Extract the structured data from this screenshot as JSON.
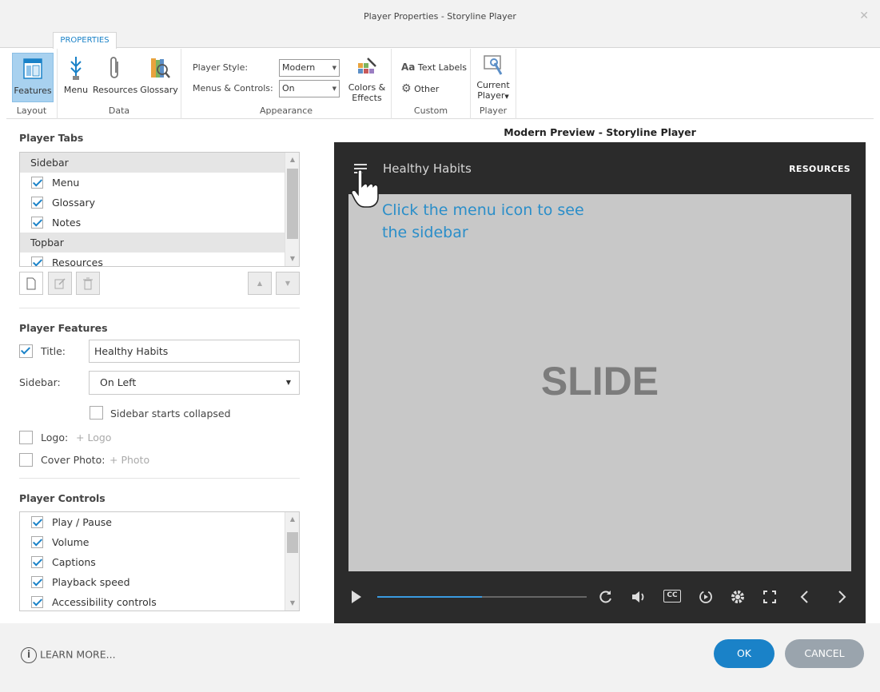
{
  "window": {
    "title": "Player Properties - Storyline Player"
  },
  "ribbon": {
    "tab": "PROPERTIES",
    "groups": {
      "layout": {
        "label": "Layout",
        "features": "Features"
      },
      "data": {
        "label": "Data",
        "menu": "Menu",
        "resources": "Resources",
        "glossary": "Glossary"
      },
      "appearance": {
        "label": "Appearance",
        "player_style_label": "Player Style:",
        "player_style_value": "Modern",
        "menus_controls_label": "Menus & Controls:",
        "menus_controls_value": "On",
        "colors_line1": "Colors &",
        "colors_line2": "Effects"
      },
      "custom": {
        "label": "Custom",
        "text_labels": "Text Labels",
        "other": "Other",
        "aa": "Aa"
      },
      "player": {
        "label": "Player",
        "current_line1": "Current",
        "current_line2": "Player"
      }
    }
  },
  "player_tabs": {
    "title": "Player Tabs",
    "rows": [
      {
        "type": "header",
        "label": "Sidebar"
      },
      {
        "type": "item",
        "label": "Menu",
        "checked": true
      },
      {
        "type": "item",
        "label": "Glossary",
        "checked": true
      },
      {
        "type": "item",
        "label": "Notes",
        "checked": true
      },
      {
        "type": "header",
        "label": "Topbar"
      },
      {
        "type": "item",
        "label": "Resources",
        "checked": true
      }
    ]
  },
  "player_features": {
    "title": "Player Features",
    "title_label": "Title:",
    "title_value": "Healthy Habits",
    "sidebar_label": "Sidebar:",
    "sidebar_value": "On Left",
    "sidebar_collapsed_label": "Sidebar starts collapsed",
    "logo_label": "Logo:",
    "logo_add": "+ Logo",
    "cover_label": "Cover Photo:",
    "cover_add": "+ Photo"
  },
  "player_controls": {
    "title": "Player Controls",
    "items": [
      {
        "label": "Play / Pause",
        "checked": true
      },
      {
        "label": "Volume",
        "checked": true
      },
      {
        "label": "Captions",
        "checked": true
      },
      {
        "label": "Playback speed",
        "checked": true
      },
      {
        "label": "Accessibility controls",
        "checked": true
      }
    ]
  },
  "preview": {
    "heading": "Modern Preview - Storyline Player",
    "course_title": "Healthy Habits",
    "resources": "RESOURCES",
    "hint": "Click the menu icon to see the sidebar",
    "slide_text": "SLIDE",
    "seek_progress": 0.5,
    "cc": "CC",
    "accent": "#3a9be0"
  },
  "footer": {
    "learn_more": "LEARN MORE...",
    "ok": "OK",
    "cancel": "CANCEL",
    "ok_color": "#1a82c8",
    "cancel_color": "#9aa4ad"
  }
}
